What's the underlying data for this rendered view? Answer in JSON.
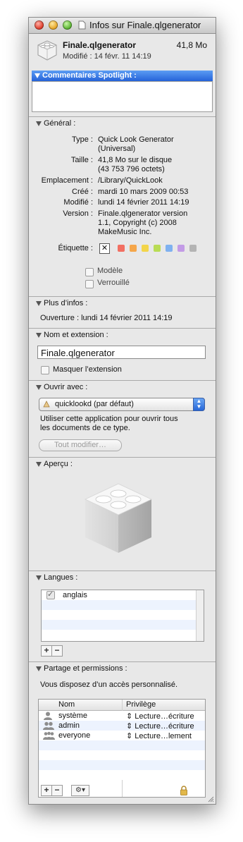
{
  "window": {
    "title": "Infos sur Finale.qlgenerator"
  },
  "header": {
    "name": "Finale.qlgenerator",
    "size": "41,8 Mo",
    "modified": "Modifié : 14 févr. 11 14:19"
  },
  "spotlight": {
    "label": "Commentaires Spotlight :",
    "value": ""
  },
  "general": {
    "heading": "Général :",
    "rows": [
      {
        "label": "Type :",
        "lines": [
          "Quick Look Generator",
          "(Universal)"
        ]
      },
      {
        "label": "Taille :",
        "lines": [
          "41,8 Mo sur le disque",
          "(43 753 796 octets)"
        ]
      },
      {
        "label": "Emplacement :",
        "lines": [
          "/Library/QuickLook"
        ]
      },
      {
        "label": "Créé :",
        "lines": [
          "mardi 10 mars 2009 00:53"
        ]
      },
      {
        "label": "Modifié :",
        "lines": [
          "lundi 14 février 2011 14:19"
        ]
      },
      {
        "label": "Version :",
        "lines": [
          "Finale.qlgenerator version",
          "1.1, Copyright (c) 2008",
          "MakeMusic Inc."
        ]
      }
    ],
    "label_text": "Étiquette :",
    "label_none": "✕",
    "label_colors": [
      "#f26f62",
      "#f5a64a",
      "#f3d54a",
      "#b9dc55",
      "#7fb1f0",
      "#c39be6",
      "#b4b4b4"
    ],
    "stationery": "Modèle",
    "locked": "Verrouillé"
  },
  "more_info": {
    "heading": "Plus d’infos :",
    "last_opened": "Ouverture : lundi 14 février 2011 14:19"
  },
  "name_ext": {
    "heading": "Nom et extension :",
    "value": "Finale.qlgenerator",
    "hide_ext": "Masquer l’extension"
  },
  "open_with": {
    "heading": "Ouvrir avec :",
    "app": "quicklookd (par défaut)",
    "desc_line1": "Utiliser cette application pour ouvrir tous",
    "desc_line2": "les documents de ce type.",
    "change_all": "Tout modifier…"
  },
  "preview": {
    "heading": "Aperçu :"
  },
  "languages": {
    "heading": "Langues :",
    "items": [
      {
        "name": "anglais",
        "checked": true
      }
    ],
    "add": "+",
    "remove": "−"
  },
  "sharing": {
    "heading": "Partage et permissions :",
    "access": "Vous disposez d’un accès personnalisé.",
    "col_name": "Nom",
    "col_priv": "Privilège",
    "rows": [
      {
        "name": "système",
        "priv": "Lecture…écriture",
        "icon": "user-icon"
      },
      {
        "name": "admin",
        "priv": "Lecture…écriture",
        "icon": "group-icon"
      },
      {
        "name": "everyone",
        "priv": "Lecture…lement",
        "icon": "everyone-icon"
      }
    ],
    "add": "+",
    "remove": "−",
    "action": "⚙▾"
  }
}
